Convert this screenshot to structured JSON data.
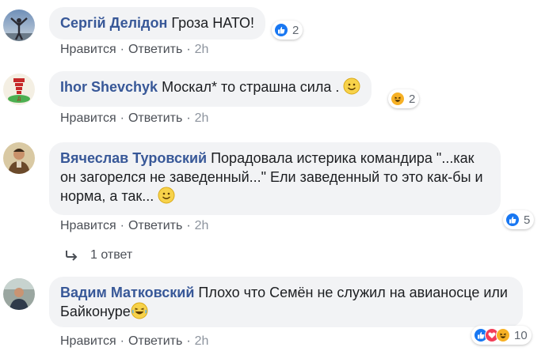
{
  "comments": [
    {
      "author": "Сергій Делідон",
      "text": "Гроза НАТО!",
      "actions": {
        "like": "Нравится",
        "reply": "Ответить",
        "time": "2h"
      },
      "reactions": {
        "icons": [
          "like-icon"
        ],
        "count": "2"
      }
    },
    {
      "author": "Ihor Shevchyk",
      "text": "Москал* то страшна сила .",
      "actions": {
        "like": "Нравится",
        "reply": "Ответить",
        "time": "2h"
      },
      "reactions": {
        "icons": [
          "laugh-icon"
        ],
        "count": "2"
      }
    },
    {
      "author": "Вячеслав Туровский",
      "text": "Порадовала истерика командира \"...как он загорелся не заведенный...\" Ели заведенный то это как-бы и норма, а так...",
      "actions": {
        "like": "Нравится",
        "reply": "Ответить",
        "time": "2h"
      },
      "reactions": {
        "icons": [
          "like-icon"
        ],
        "count": "5"
      },
      "replies_label": "1 ответ"
    },
    {
      "author": "Вадим Матковский",
      "text": "Плохо что Семён не служил на авианосце или Байконуре",
      "actions": {
        "like": "Нравится",
        "reply": "Ответить",
        "time": "2h"
      },
      "reactions": {
        "icons": [
          "like-icon",
          "love-icon",
          "laugh-icon"
        ],
        "count": "10"
      }
    }
  ],
  "colors": {
    "author": "#385898",
    "bubble": "#f2f3f5",
    "like": "#1877f2",
    "love": "#f33e58",
    "haha": "#f7b125"
  }
}
